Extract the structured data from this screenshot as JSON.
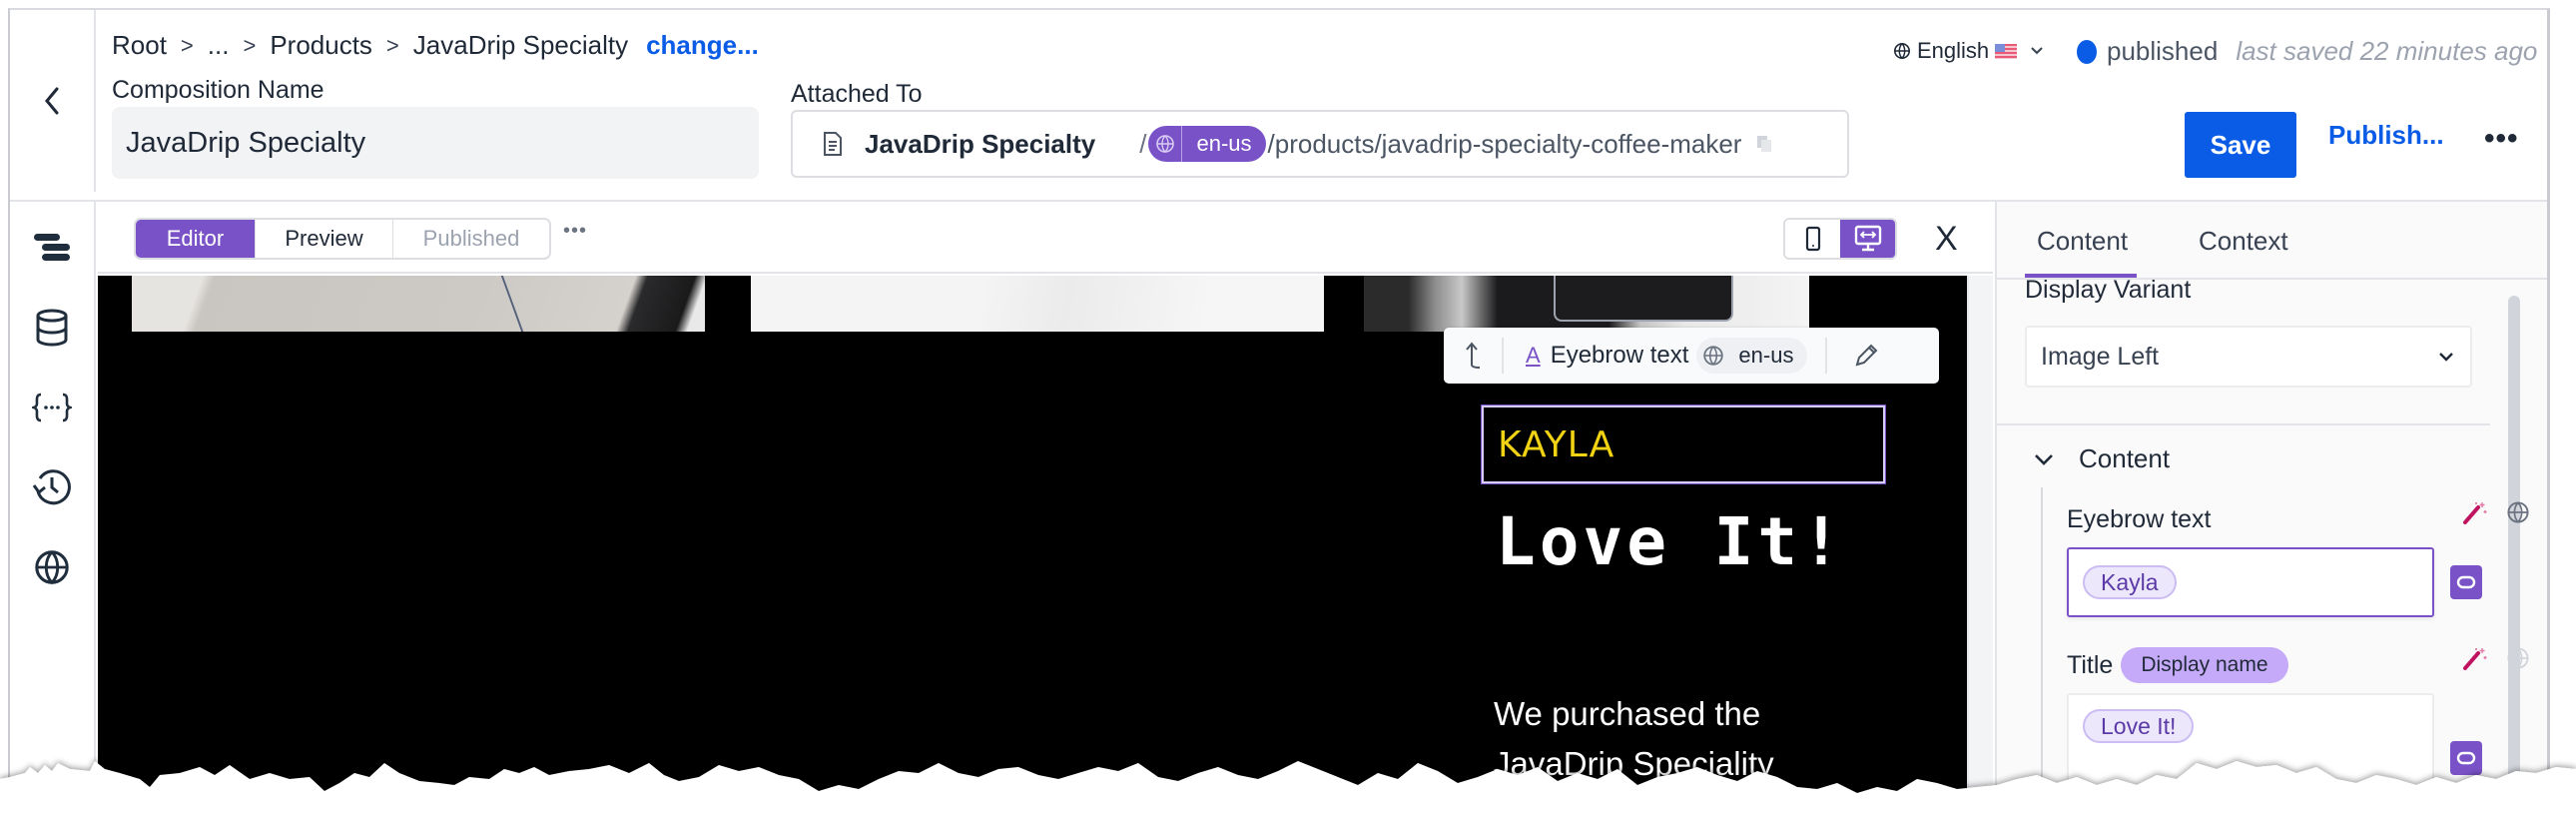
{
  "header": {
    "breadcrumb": [
      "Root",
      "...",
      "Products",
      "JavaDrip Specialty"
    ],
    "breadcrumb_separator": ">",
    "change_link": "change...",
    "composition_name_label": "Composition Name",
    "composition_name_value": "JavaDrip Specialty",
    "attached_to_label": "Attached To",
    "attached_to": {
      "name": "JavaDrip Specialty",
      "separator": "/",
      "locale": "en-us",
      "path": "/products/javadrip-specialty-coffee-maker"
    },
    "language": "English",
    "status": "published",
    "last_saved": "last saved 22 minutes ago",
    "save_label": "Save",
    "publish_label": "Publish...",
    "more_label": "•••",
    "colors": {
      "primary": "#0a5ce6",
      "accent": "#7a52c7"
    }
  },
  "rail": {
    "items": [
      {
        "icon": "structure-icon"
      },
      {
        "icon": "database-icon"
      },
      {
        "icon": "parameters-icon"
      },
      {
        "icon": "history-icon"
      },
      {
        "icon": "globe-icon"
      }
    ]
  },
  "canvas": {
    "mode_tabs": [
      {
        "label": "Editor",
        "active": true
      },
      {
        "label": "Preview",
        "active": false
      },
      {
        "label": "Published",
        "active": false,
        "disabled": true
      }
    ],
    "more_label": "•••",
    "device": "desktop",
    "close_label": "X",
    "floating_toolbar": {
      "field_label": "Eyebrow text",
      "locale": "en-us"
    },
    "eyebrow_text": "KAYLA",
    "title_text": "Love It!",
    "body_text": "We purchased the JavaDrip Speciality"
  },
  "panel": {
    "tabs": [
      {
        "label": "Content",
        "active": true
      },
      {
        "label": "Context",
        "active": false
      }
    ],
    "display_variant_label": "Display Variant",
    "display_variant_value": "Image Left",
    "section_label": "Content",
    "fields": [
      {
        "label": "Eyebrow text",
        "value_chip": "Kayla"
      },
      {
        "label": "Title",
        "badge": "Display name",
        "value_chip": "Love It!"
      }
    ]
  }
}
